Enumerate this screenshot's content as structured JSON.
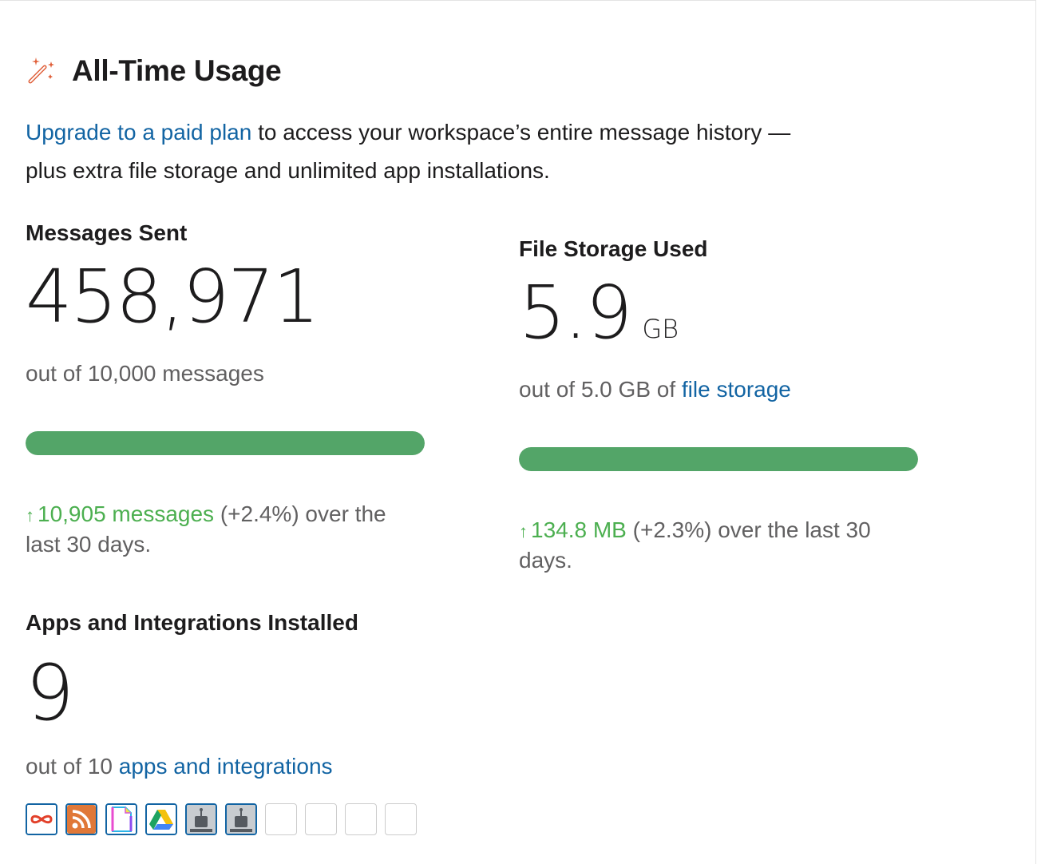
{
  "header": {
    "title": "All-Time Usage",
    "icon": "magic-wand-icon"
  },
  "intro": {
    "link_text": "Upgrade to a paid plan",
    "rest_text": " to access your workspace’s entire message history — plus extra file storage and unlimited app installations."
  },
  "messages": {
    "label": "Messages Sent",
    "value": "458,971",
    "sub": "out of 10,000 messages",
    "progress_fraction": 1.0,
    "trend_amount": "10,905 messages",
    "trend_rest": " (+2.4%) over the last 30 days."
  },
  "storage": {
    "label": "File Storage Used",
    "value": "5.9",
    "unit": "GB",
    "sub_prefix": "out of 5.0 GB of ",
    "sub_link": "file storage",
    "progress_fraction": 1.0,
    "trend_amount": "134.8 MB",
    "trend_rest": " (+2.3%) over the last 30 days."
  },
  "apps": {
    "label": "Apps and Integrations Installed",
    "value": "9",
    "sub_prefix": "out of 10 ",
    "sub_link": "apps and integrations",
    "installed_icons": [
      "infinity-app-icon",
      "rss-app-icon",
      "document-app-icon",
      "google-drive-icon",
      "bot-app-icon",
      "bot-app-icon"
    ],
    "empty_slots": 4
  },
  "colors": {
    "link": "#1264a3",
    "progress": "#53a568",
    "trend_up": "#4caf50"
  }
}
